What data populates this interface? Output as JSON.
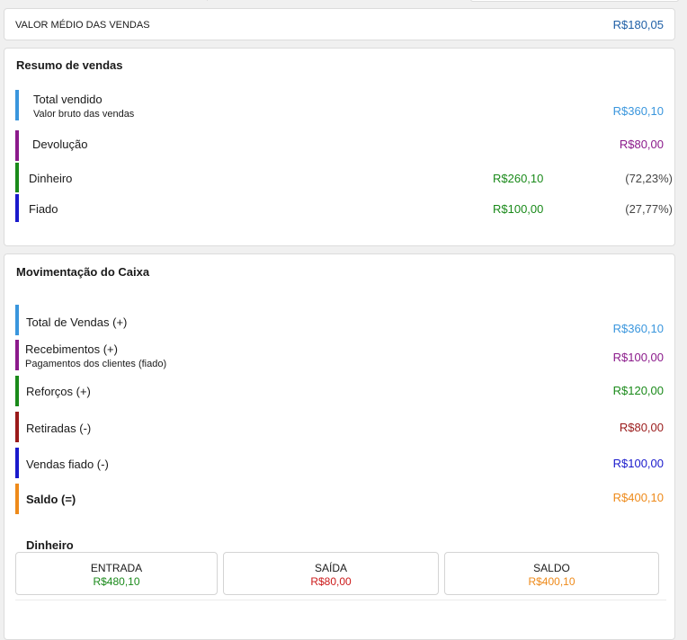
{
  "colors": {
    "light_blue": "#3a96dd",
    "purple": "#8b1a8b",
    "green": "#1a8a1a",
    "navy": "#1a1acc",
    "dark_red": "#9a1a1a",
    "orange": "#ee8a1a",
    "red": "#cc1a1a",
    "steel_blue": "#1f5fa6"
  },
  "avg": {
    "label": "VALOR MÉDIO DAS VENDAS",
    "value": "R$180,05"
  },
  "resumo": {
    "title": "Resumo de vendas",
    "total_label": "Total vendido",
    "total_sub": "Valor bruto das vendas",
    "total_value": "R$360,10",
    "devolucao_label": "Devolução",
    "devolucao_value": "R$80,00",
    "dinheiro_label": "Dinheiro",
    "dinheiro_value": "R$260,10",
    "dinheiro_pct": "(72,23%)",
    "fiado_label": "Fiado",
    "fiado_value": "R$100,00",
    "fiado_pct": "(27,77%)"
  },
  "caixa": {
    "title": "Movimentação do Caixa",
    "total_label": "Total de Vendas (+)",
    "total_value": "R$360,10",
    "receb_label": "Recebimentos (+)",
    "receb_sub": "Pagamentos dos clientes (fiado)",
    "receb_value": "R$100,00",
    "reforcos_label": "Reforços (+)",
    "reforcos_value": "R$120,00",
    "retiradas_label": "Retiradas (-)",
    "retiradas_value": "R$80,00",
    "vfiado_label": "Vendas fiado (-)",
    "vfiado_value": "R$100,00",
    "saldo_label": "Saldo (=)",
    "saldo_value": "R$400,10"
  },
  "dinheiro": {
    "title": "Dinheiro",
    "entrada_label": "ENTRADA",
    "entrada_value": "R$480,10",
    "saida_label": "SAÍDA",
    "saida_value": "R$80,00",
    "saldo_label": "SALDO",
    "saldo_value": "R$400,10"
  }
}
